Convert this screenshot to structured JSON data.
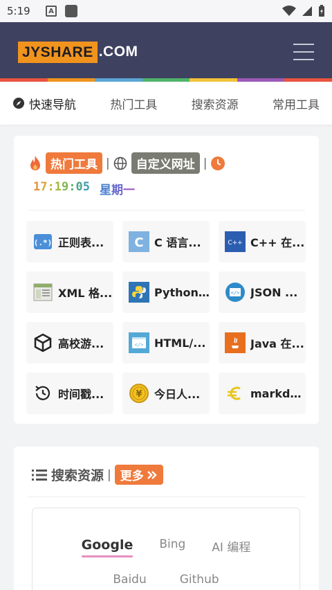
{
  "status_bar": {
    "time": "5:19",
    "a_icon": "A"
  },
  "header": {
    "logo_box": "JYSHARE",
    "logo_rest": ".COM",
    "rainbow_colors": [
      "#e8533f",
      "#f0941e",
      "#5aa5d6",
      "#4fb36a",
      "#f2c23a",
      "#9b59b6",
      "#e8533f"
    ]
  },
  "nav": {
    "tabs": [
      {
        "label": "快速导航",
        "icon": "compass-icon",
        "active": true
      },
      {
        "label": "热门工具"
      },
      {
        "label": "搜索资源"
      },
      {
        "label": "常用工具"
      }
    ]
  },
  "hot": {
    "hot_tag": "热门工具",
    "custom_tag": "自定义网址",
    "separator": "|",
    "time": "17:19:05",
    "time_colors": [
      "#e8903a",
      "#dca63a",
      "#c8b23c",
      "#a4b744",
      "#7eb650",
      "#5aae6a",
      "#4aa58c",
      "#3f9bb0"
    ],
    "weekday": "星期一",
    "tools": [
      {
        "label": "正则表...",
        "icon": "regex-icon"
      },
      {
        "label": "C 语言...",
        "icon": "c-lang-icon"
      },
      {
        "label": "C++ 在...",
        "icon": "cpp-icon"
      },
      {
        "label": "XML 格...",
        "icon": "xml-icon"
      },
      {
        "label": "Python...",
        "icon": "python-icon"
      },
      {
        "label": "JSON ...",
        "icon": "json-icon"
      },
      {
        "label": "高校游...",
        "icon": "unity-icon"
      },
      {
        "label": "HTML/...",
        "icon": "html-icon"
      },
      {
        "label": "Java 在...",
        "icon": "java-icon"
      },
      {
        "label": "时间戳...",
        "icon": "history-icon"
      },
      {
        "label": "今日人...",
        "icon": "yen-coin-icon"
      },
      {
        "label": "markdo...",
        "icon": "euro-icon"
      }
    ]
  },
  "search": {
    "title": "搜索资源",
    "separator": "|",
    "more_label": "更多",
    "engines_row1": [
      "Google",
      "Bing",
      "AI 编程"
    ],
    "engines_row2": [
      "Baidu",
      "Github"
    ]
  },
  "colors": {
    "accent": "#ef7a3c",
    "header_bg": "#3e4160",
    "logo_orange": "#f0941e"
  }
}
